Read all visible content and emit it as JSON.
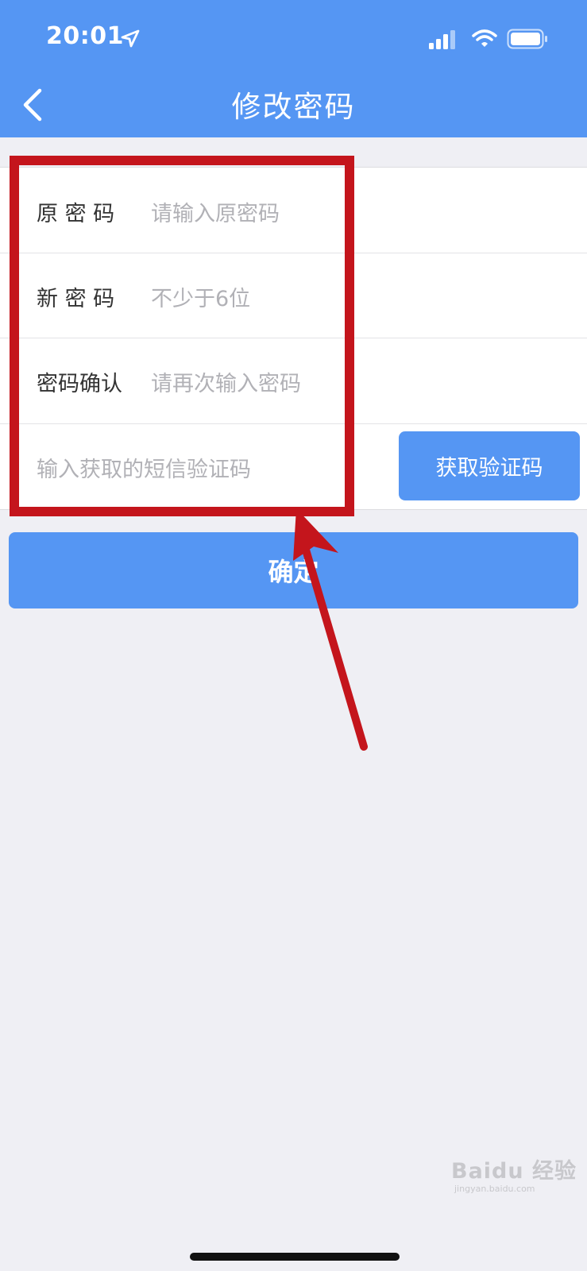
{
  "status_bar": {
    "time": "20:01"
  },
  "nav": {
    "title": "修改密码"
  },
  "form": {
    "rows": [
      {
        "label": "原 密 码",
        "placeholder": "请输入原密码"
      },
      {
        "label": "新 密 码",
        "placeholder": "不少于6位"
      },
      {
        "label": "密码确认",
        "placeholder": "请再次输入密码"
      }
    ],
    "sms_placeholder": "输入获取的短信验证码",
    "get_code_label": "获取验证码"
  },
  "confirm_label": "确定",
  "watermark": {
    "brand": "Baidu 经验",
    "url": "jingyan.baidu.com"
  },
  "colors": {
    "primary": "#5596f3",
    "highlight": "#c4151c"
  }
}
